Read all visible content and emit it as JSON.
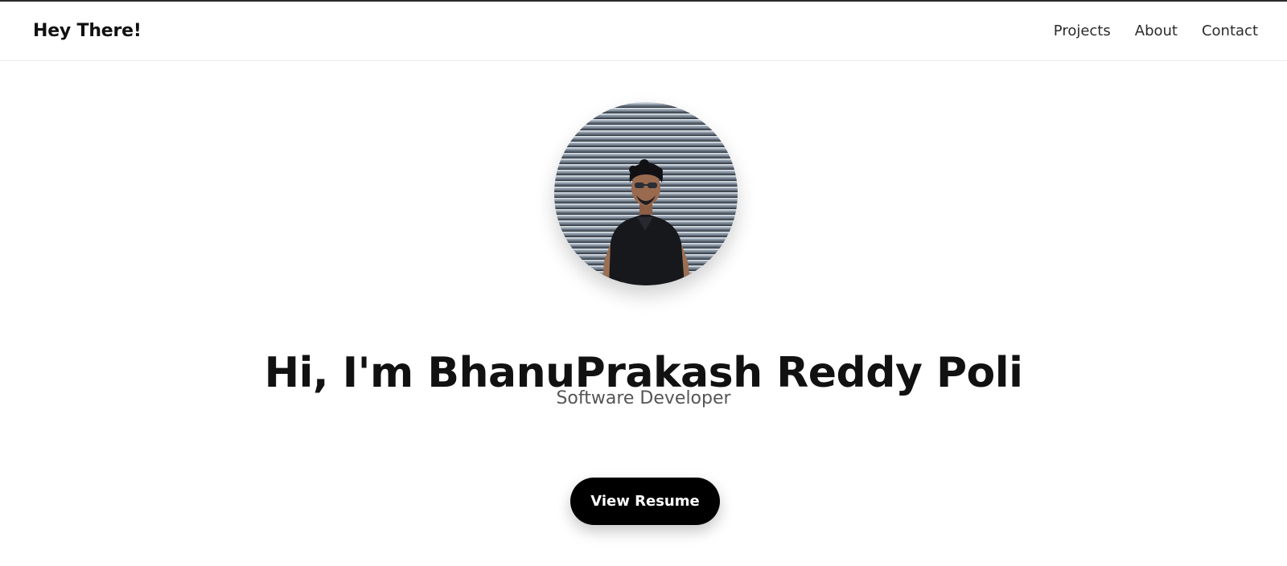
{
  "header": {
    "brand": "Hey There!",
    "nav": [
      "Projects",
      "About",
      "Contact"
    ]
  },
  "hero": {
    "avatar_alt": "profile-photo",
    "headline": "Hi, I'm BhanuPrakash Reddy Poli",
    "subtitle": "Software Developer",
    "cta_label": "View Resume"
  },
  "colors": {
    "text": "#111111",
    "subtitle": "#555555",
    "button_bg": "#000000",
    "button_text": "#ffffff"
  }
}
